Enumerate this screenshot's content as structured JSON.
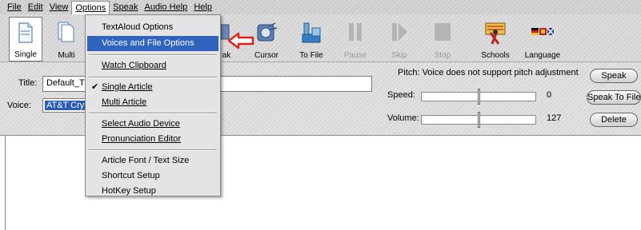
{
  "menubar": {
    "items": [
      {
        "label": "File"
      },
      {
        "label": "Edit"
      },
      {
        "label": "View"
      },
      {
        "label": "Options"
      },
      {
        "label": "Speak"
      },
      {
        "label": "Audio Help"
      },
      {
        "label": "Help"
      }
    ]
  },
  "toolbar": {
    "single": "Single",
    "multi": "Multi",
    "speak_partial": "ak",
    "cursor": "Cursor",
    "to_file": "To File",
    "pause": "Pause",
    "skip": "Skip",
    "stop": "Stop",
    "schools": "Schools",
    "language": "Language"
  },
  "panel": {
    "title_label": "Title:",
    "title_value": "Default_T",
    "voice_label": "Voice:",
    "voice_value": "AT&T Cry",
    "pitch_text": "Pitch: Voice does not support pitch adjustment",
    "speed_label": "Speed:",
    "speed_value": "0",
    "speed_level": 0.5,
    "volume_label": "Volume:",
    "volume_value": "127",
    "volume_level": 0.5,
    "speak_button": "Speak",
    "speak_to_file_button": "Speak To File",
    "delete_button": "Delete"
  },
  "options_menu": {
    "items": [
      "TextAloud Options",
      "Voices and File Options",
      "Watch Clipboard",
      "Single Article",
      "Multi Article",
      "Select Audio Device",
      "Pronunciation Editor",
      "Article Font / Text Size",
      "Shortcut Setup",
      "HotKey Setup"
    ],
    "checked_item": "Single Article",
    "highlighted_item": "Voices and File Options"
  },
  "colors": {
    "highlight": "#2f63be",
    "arrow": "#e02020"
  }
}
